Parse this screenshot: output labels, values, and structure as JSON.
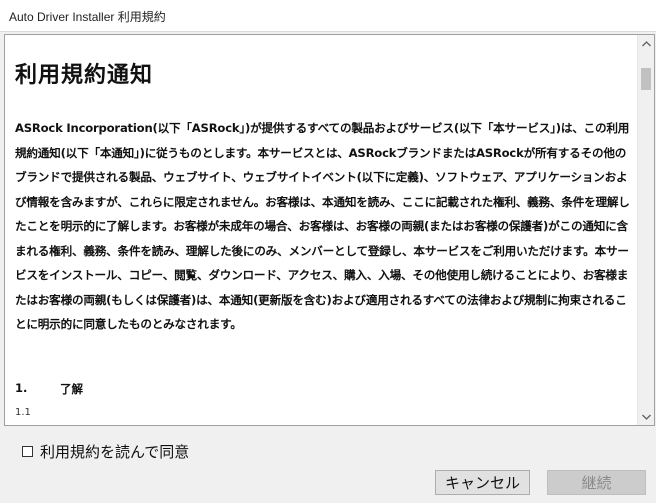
{
  "window": {
    "title": "Auto Driver Installer 利用規約"
  },
  "document": {
    "heading": "利用規約通知",
    "paragraph": "ASRock Incorporation(以下「ASRock」)が提供するすべての製品およびサービス(以下「本サービス」)は、この利用規約通知(以下「本通知」)に従うものとします。本サービスとは、ASRockブランドまたはASRockが所有するその他のブランドで提供される製品、ウェブサイト、ウェブサイトイベント(以下に定義)、ソフトウェア、アプリケーションおよび情報を含みますが、これらに限定されません。お客様は、本通知を読み、ここに記載された権利、義務、条件を理解したことを明示的に了解します。お客様が未成年の場合、お客様は、お客様の両親(またはお客様の保護者)がこの通知に含まれる権利、義務、条件を読み、理解した後にのみ、メンバーとして登録し、本サービスをご利用いただけます。本サービスをインストール、コピー、閲覧、ダウンロード、アクセス、購入、入場、その他使用し続けることにより、お客様またはお客様の両親(もしくは保護者)は、本通知(更新版を含む)および適用されるすべての法律および規制に拘束されることに明示的に同意したものとみなされます。",
    "section_number": "1.",
    "section_title": "了解",
    "subsection_number": "1.1"
  },
  "agreement": {
    "checkbox_label": "利用規約を読んで同意",
    "checked": false
  },
  "buttons": {
    "cancel_label": "キャンセル",
    "next_label": "継続",
    "next_enabled": false
  },
  "icons": {
    "scroll_up": "chevron-up-icon",
    "scroll_down": "chevron-down-icon"
  }
}
